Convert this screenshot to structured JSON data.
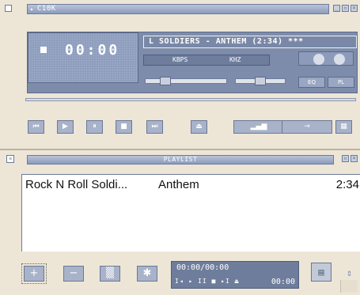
{
  "player": {
    "title": "C10K",
    "time": "00:00",
    "marquee": "L SOLDIERS - ANTHEM (2:34) ***",
    "kbps_label": "KBPS",
    "khz_label": "KHZ",
    "eq_label": "EQ",
    "pl_label": "PL",
    "controls": {
      "prev": "⏮",
      "play": "▶",
      "pause": "⏸",
      "stop": "■",
      "next": "⏭",
      "eject": "⏏",
      "volume_icon": "▂▄▆",
      "shuffle_icon": "→",
      "grid_icon": "▦"
    }
  },
  "playlist": {
    "title": "PLAYLIST",
    "tracks": [
      {
        "artist": "Rock N Roll Soldi...",
        "title": "Anthem",
        "duration": "2:34"
      }
    ],
    "buttons": {
      "add": "+",
      "remove": "−",
      "select": "▒",
      "misc": "✱"
    },
    "time": "00:00/00:00",
    "mini_controls": "I◂ ▸ II ■ ▸I ⏏",
    "time_remaining": "00:00",
    "menu_icon": "▤"
  }
}
